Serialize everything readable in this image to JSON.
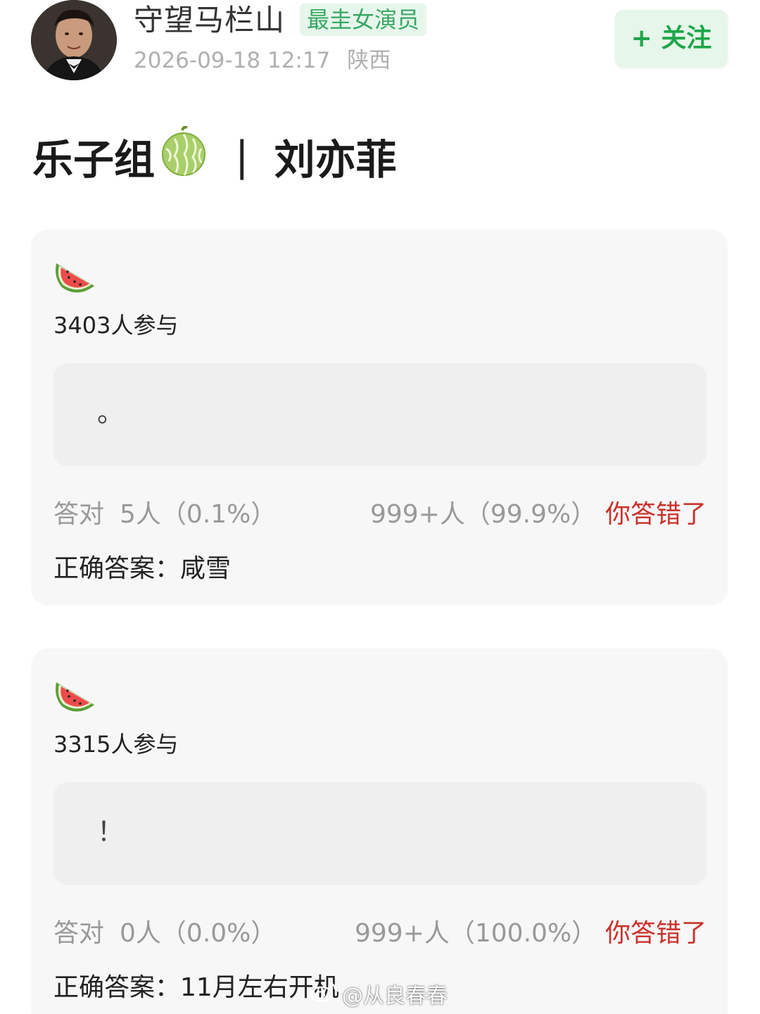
{
  "header": {
    "username": "守望马栏山",
    "badge": "最圭女演员",
    "timestamp": "2026-09-18 12:17",
    "location": "陕西",
    "follow_label": "+ 关注"
  },
  "post": {
    "title_left": "乐子组",
    "title_separator": "|",
    "title_right": "刘亦菲"
  },
  "quizzes": [
    {
      "participants": "3403人参与",
      "question": "。",
      "correct_label": "答对",
      "correct_count": "5人（0.1%）",
      "wrong_count": "999+人（99.9%）",
      "result": "你答错了",
      "answer": "正确答案：咸雪"
    },
    {
      "participants": "3315人参与",
      "question": "！",
      "correct_label": "答对",
      "correct_count": "0人（0.0%）",
      "wrong_count": "999+人（100.0%）",
      "result": "你答错了",
      "answer": "正确答案：11月左右开机"
    }
  ],
  "watermark": "@从良春春",
  "colors": {
    "accent_green": "#1fa64a",
    "badge_green": "#3aa864",
    "wrong_red": "#c9322b",
    "card_bg": "#f7f7f7"
  },
  "icons": {
    "avatar": "user-avatar",
    "title_icon": "melon-icon",
    "card_icon": "watermelon-icon",
    "watermark_icon": "weibo-icon"
  }
}
